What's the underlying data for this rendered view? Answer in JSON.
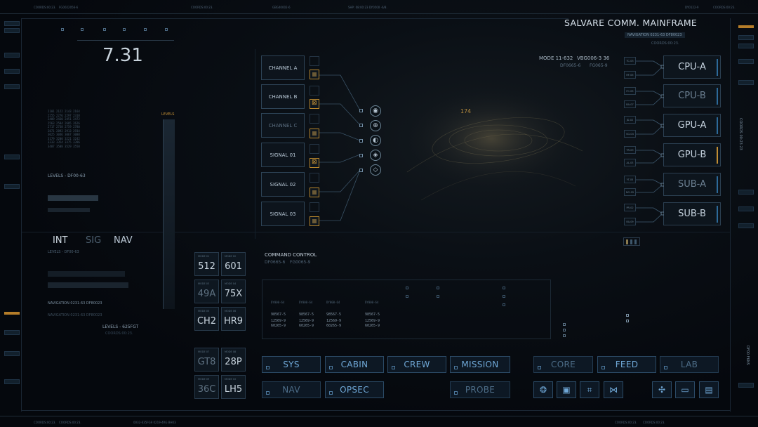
{
  "top_bar": {
    "coords_left": "COORDS:00:23.",
    "code_left": "FG0022056-6",
    "coords_mid": "COORDS:00:23.",
    "code_mid": "GBG40002-6",
    "ship": "SHP: 08:00:23 DY0500 -6/8.",
    "code_right": "DY0122-9",
    "coords_right": "COORDS:00:23."
  },
  "header": {
    "title": "SALVARE COMM. MAINFRAME",
    "navigation": "NAVIGATION 0231-63  DF80023",
    "coords": "COORDS:00:23."
  },
  "left_panel": {
    "big_readout": "7.31",
    "levels_header": "LEVELS",
    "levels_line": "LEVELS - DF00-63",
    "tabs": [
      "INT",
      "SIG",
      "NAV"
    ],
    "levels_sub": "LEVELS - DF00-63",
    "navigation_1": "NAVIGATION 0231-63   DF80023",
    "navigation_2": "NAVIGATION 0231-63   DF80023",
    "levels_footer": "LEVELS - 625FGT",
    "coords_footer": "COORDS:00:23."
  },
  "channels": {
    "items": [
      {
        "label": "CHANNEL A",
        "state": "active"
      },
      {
        "label": "CHANNEL B",
        "state": "active"
      },
      {
        "label": "CHANNEL C",
        "state": "dim"
      },
      {
        "label": "SIGNAL 01",
        "state": "active"
      },
      {
        "label": "SIGNAL 02",
        "state": "active"
      },
      {
        "label": "SIGNAL 03",
        "state": "active"
      }
    ]
  },
  "center": {
    "number_label": "174",
    "mode": "MODE 11-632",
    "vbg": "VBG006-3  36",
    "df": "DF0665-6",
    "fg": "FG065-9"
  },
  "processors": {
    "items": [
      {
        "label": "CPU-A",
        "bar": "blue",
        "state": "active"
      },
      {
        "label": "CPU-B",
        "bar": "blue",
        "state": "dim"
      },
      {
        "label": "GPU-A",
        "bar": "blue",
        "state": "active"
      },
      {
        "label": "GPU-B",
        "bar": "amber",
        "state": "active"
      },
      {
        "label": "SUB-A",
        "bar": "blue",
        "state": "dim"
      },
      {
        "label": "SUB-B",
        "bar": "blue",
        "state": "active"
      }
    ]
  },
  "tiles": [
    {
      "label": "512",
      "state": "active"
    },
    {
      "label": "601",
      "state": "active"
    },
    {
      "label": "49A",
      "state": "dim"
    },
    {
      "label": "75X",
      "state": "active"
    },
    {
      "label": "CH2",
      "state": "active"
    },
    {
      "label": "HR9",
      "state": "active"
    },
    {
      "label": "GT8",
      "state": "dim"
    },
    {
      "label": "28P",
      "state": "active"
    },
    {
      "label": "36C",
      "state": "dim"
    },
    {
      "label": "LH5",
      "state": "active"
    }
  ],
  "command_control": {
    "title": "COMMAND CONTROL",
    "sub1": "DF0665-6",
    "sub2": "FG0065-9",
    "columns": [
      {
        "head": "DY000-64",
        "rows": [
          "98567-5",
          "12569-9",
          "60265-9"
        ]
      },
      {
        "head": "DY000-64",
        "rows": [
          "98567-5",
          "12569-9",
          "60265-9"
        ]
      },
      {
        "head": "DY000-64",
        "rows": [
          "98567-5",
          "12569-9",
          "60265-9"
        ]
      },
      {
        "head": "DY000-64",
        "rows": [
          "98567-5",
          "12569-9",
          "60265-9"
        ]
      }
    ]
  },
  "buttons_row1": [
    "SYS",
    "CABIN",
    "CREW",
    "MISSION",
    "CORE",
    "FEED",
    "LAB"
  ],
  "buttons_row2": [
    "NAV",
    "OPSEC",
    "PROBE"
  ],
  "icon_buttons": [
    "network-icon",
    "chip-icon",
    "processor-icon",
    "bowtie-icon",
    "nodes-icon",
    "battery-icon",
    "monitor-icon"
  ],
  "bottom_bar": {
    "coords_1": "COORDS:00:23.",
    "coords_2": "COORDS:00:23.",
    "codes": "0032-635FG9  0219-4RG  BH03",
    "coords_right_1": "COORDS:00:23.",
    "coords_right_2": "COORDS:00:23."
  },
  "right_edge": {
    "coords_vertical": "COORDS 00:23.23",
    "code_vertical": "DF00 F6NS"
  },
  "colors": {
    "accent_blue": "#6fa7d6",
    "amber": "#c28e34",
    "text_bright": "#d6e0ea"
  }
}
